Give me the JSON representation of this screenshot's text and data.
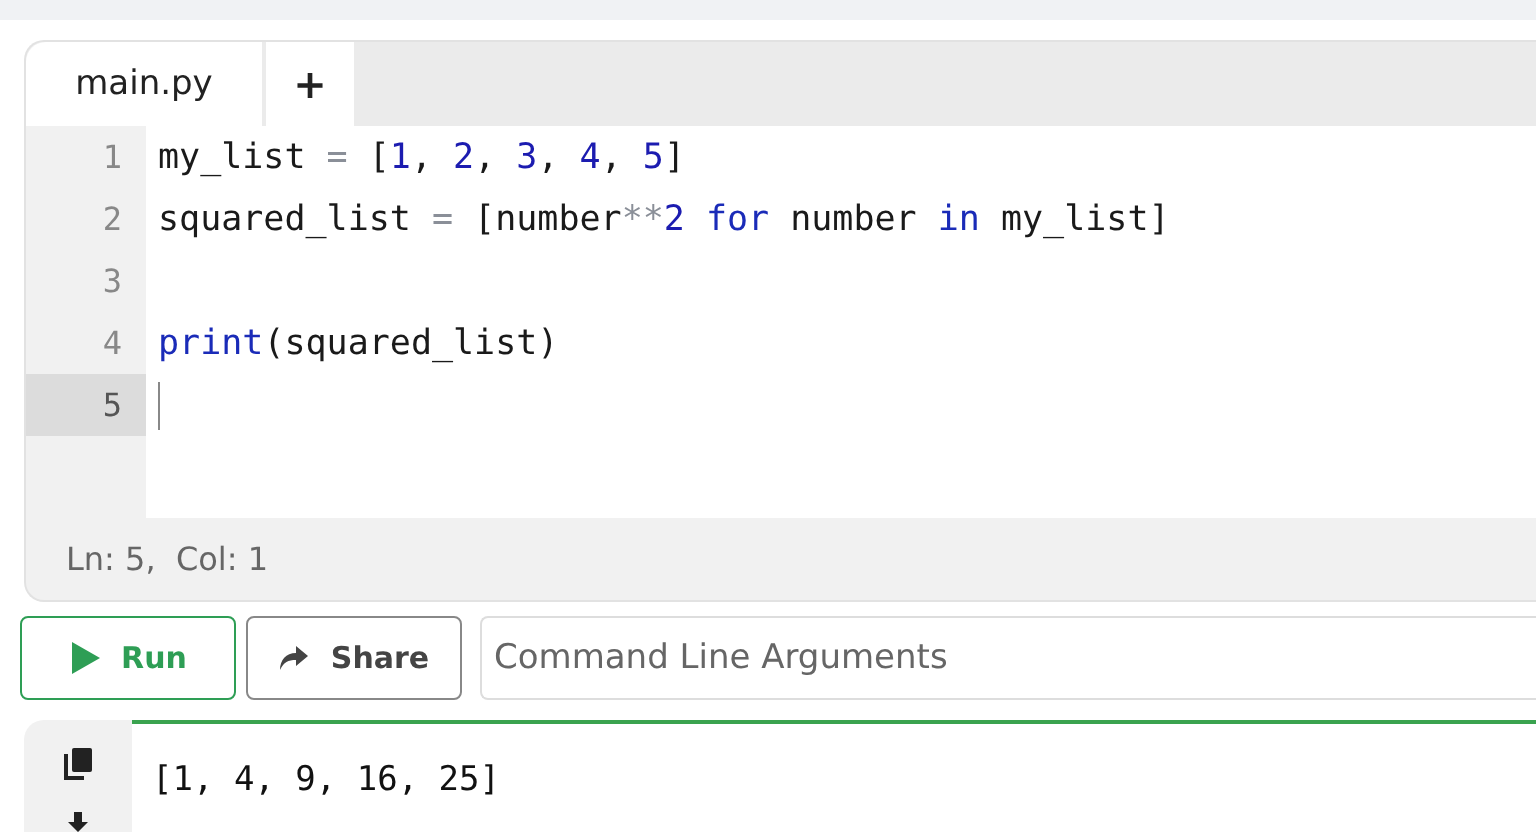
{
  "tabs": [
    {
      "label": "main.py",
      "selected": true
    },
    {
      "label": "+",
      "selected": false
    }
  ],
  "editor": {
    "lines": [
      {
        "number": "1",
        "active": false,
        "tokens": [
          {
            "text": "my_list ",
            "kind": "plain"
          },
          {
            "text": "=",
            "kind": "op"
          },
          {
            "text": " [",
            "kind": "plain"
          },
          {
            "text": "1",
            "kind": "number"
          },
          {
            "text": ", ",
            "kind": "plain"
          },
          {
            "text": "2",
            "kind": "number"
          },
          {
            "text": ", ",
            "kind": "plain"
          },
          {
            "text": "3",
            "kind": "number"
          },
          {
            "text": ", ",
            "kind": "plain"
          },
          {
            "text": "4",
            "kind": "number"
          },
          {
            "text": ", ",
            "kind": "plain"
          },
          {
            "text": "5",
            "kind": "number"
          },
          {
            "text": "]",
            "kind": "plain"
          }
        ]
      },
      {
        "number": "2",
        "active": false,
        "tokens": [
          {
            "text": "squared_list ",
            "kind": "plain"
          },
          {
            "text": "=",
            "kind": "op"
          },
          {
            "text": " [number",
            "kind": "plain"
          },
          {
            "text": "**",
            "kind": "op"
          },
          {
            "text": "2 ",
            "kind": "number"
          },
          {
            "text": "for",
            "kind": "keyword"
          },
          {
            "text": " number ",
            "kind": "plain"
          },
          {
            "text": "in",
            "kind": "keyword"
          },
          {
            "text": " my_list]",
            "kind": "plain"
          }
        ]
      },
      {
        "number": "3",
        "active": false
      },
      {
        "number": "4",
        "active": false,
        "tokens": [
          {
            "text": "print",
            "kind": "keyword"
          },
          {
            "text": "(squared_list)",
            "kind": "plain"
          }
        ]
      },
      {
        "number": "5",
        "active": true
      }
    ],
    "status": "Ln: 5,  Col: 1"
  },
  "toolbar": {
    "run": "Run",
    "share": "Share",
    "arguments_placeholder": "Command Line Arguments"
  },
  "output": {
    "text": "[1, 4, 9, 16, 25]"
  }
}
